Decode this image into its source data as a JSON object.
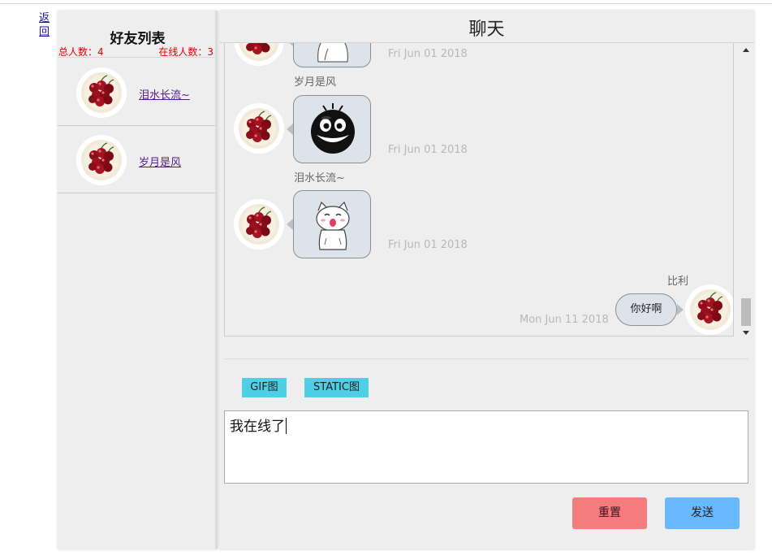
{
  "nav": {
    "back_label": "返回"
  },
  "friends": {
    "title": "好友列表",
    "total_label": "总人数：4",
    "online_label": "在线人数：3",
    "items": [
      {
        "name": "泪水长流~",
        "avatar_icon": "cherry-plate-avatar"
      },
      {
        "name": "岁月是风",
        "avatar_icon": "cherry-plate-avatar"
      }
    ]
  },
  "chat": {
    "title": "聊天",
    "messages": [
      {
        "sender": "",
        "time": "Fri Jun 01 2018",
        "content_icon": "white-cat-sticker",
        "side": "left"
      },
      {
        "sender": "岁月是风",
        "time": "Fri Jun 01 2018",
        "content_icon": "black-grinning-face-sticker",
        "side": "left"
      },
      {
        "sender": "泪水长流~",
        "time": "Fri Jun 01 2018",
        "content_icon": "white-cat-sticker",
        "side": "left"
      },
      {
        "sender": "比利",
        "time": "Mon Jun 11 2018",
        "text": "你好啊",
        "side": "right"
      }
    ],
    "toolbar": {
      "gif_label": "GIF图",
      "static_label": "STATIC图"
    },
    "input": {
      "value": "我在线了"
    },
    "actions": {
      "reset_label": "重置",
      "send_label": "发送"
    }
  },
  "colors": {
    "accent_cyan": "#4fcfe6",
    "reset_red": "#f47c7c",
    "send_blue": "#68b8ff",
    "stats_red": "#e00000"
  }
}
